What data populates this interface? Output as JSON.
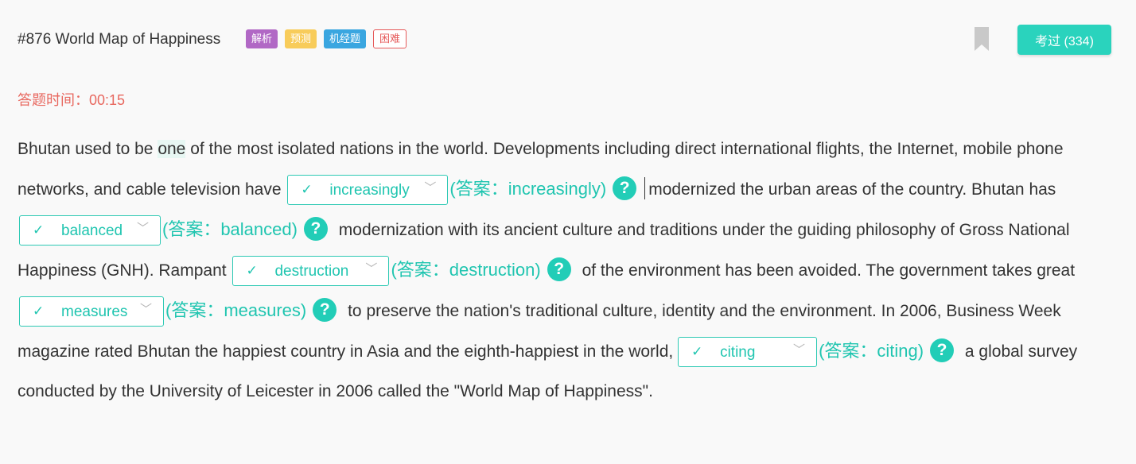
{
  "header": {
    "title": "#876 World Map of Happiness",
    "tags": [
      "解析",
      "预测",
      "机经题",
      "困难"
    ],
    "exam_button": "考过 (334)"
  },
  "timer": {
    "label": "答题时间：",
    "value": "00:15"
  },
  "passage": {
    "s0": "Bhutan used to be ",
    "s0_hl": "one",
    "s0b": " of the most isolated nations in the world. Developments including direct international flights, the Internet, mobile phone networks, and cable television have",
    "s1": "modernized the urban areas of the country. Bhutan has",
    "s2": "modernization with its ancient culture and traditions under the guiding philosophy of Gross National Happiness (GNH). Rampant",
    "s3": "of the environment has been avoided. The government takes great",
    "s4": "to preserve the nation's traditional culture, identity and the environment. In 2006, Business Week magazine rated Bhutan the happiest country in Asia and the eighth-happiest in the world,",
    "s5": "a global survey conducted by the University of Leicester in 2006 called the \"World Map of Happiness\"."
  },
  "blanks": [
    {
      "value": "increasingly",
      "answer": "(答案：increasingly)"
    },
    {
      "value": "balanced",
      "answer": "(答案：balanced)"
    },
    {
      "value": "destruction",
      "answer": "(答案：destruction)"
    },
    {
      "value": "measures",
      "answer": "(答案：measures)"
    },
    {
      "value": "citing",
      "answer": "(答案：citing)"
    }
  ],
  "icons": {
    "check": "check-icon",
    "chevron": "chevron-down-icon",
    "help": "question-icon",
    "bookmark": "bookmark-icon"
  },
  "colors": {
    "accent": "#2ad3bd",
    "timer": "#e8685f",
    "tag_analysis": "#b168c5",
    "tag_predict": "#f8cc5a",
    "tag_jijing": "#3aa6e0",
    "tag_hard": "#e65a5a"
  }
}
